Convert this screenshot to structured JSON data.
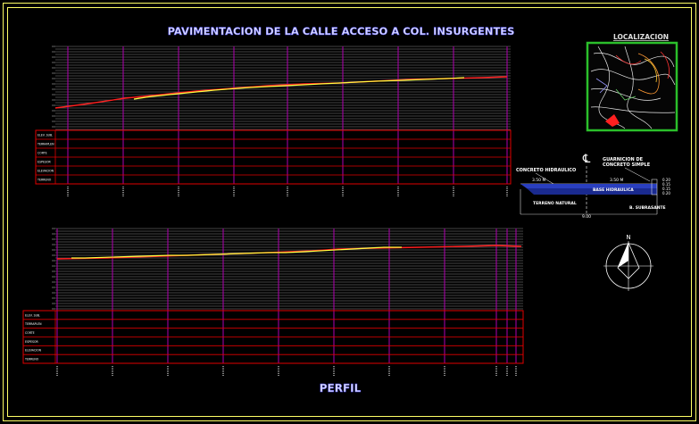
{
  "title": "PAVIMENTACION DE LA CALLE ACCESO A COL. INSURGENTES",
  "location_label": "LOCALIZACION",
  "bottom_label": "PERFIL",
  "north_label": "N",
  "section": {
    "centerline_symbol": "℄",
    "left_callout": "CONCRETO HIDRAULICO",
    "right_callout_1": "GUARNICION DE",
    "right_callout_2": "CONCRETO SIMPLE",
    "left_width": "3.50 M",
    "right_width": "3.50 M",
    "base_label": "BASE HIDRAULICA",
    "ground_label": "TERRENO NATURAL",
    "subbase_label": "B. SUBRASANTE",
    "total_width": "9.00",
    "dims": [
      "0.20",
      "0.15",
      "0.15",
      "0.20"
    ]
  },
  "profile_rows_top": [
    "ELEV. SUB.",
    "TERRAPLEN",
    "CORTE",
    "ESPESOR",
    "ELEVACION",
    "TERRENO"
  ],
  "profile_rows_bottom": [
    "ELEV. SUB.",
    "TERRAPLEN",
    "CORTE",
    "ESPESOR",
    "ELEVACION",
    "TERRENO"
  ],
  "colors": {
    "frame": "#ffff66",
    "title": "#d8d8ff",
    "grid_line": "#9a9a9a",
    "vertical_line": "#b000b0",
    "table_line": "#e00000",
    "profile_red": "#ff2020",
    "profile_yellow": "#ffff40",
    "map_border": "#2bbf2b"
  }
}
